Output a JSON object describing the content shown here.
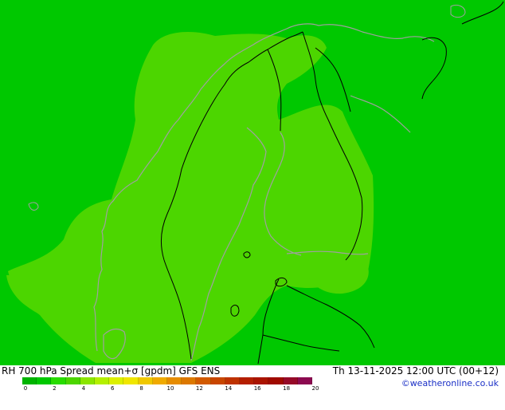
{
  "map": {
    "background_color": "#00c800",
    "field_color": "#4cd600",
    "coast_color": "#a0a0a0",
    "border_color": "#000000"
  },
  "footer": {
    "title_left": "RH 700 hPa Spread mean+σ [gpdm] GFS ENS",
    "title_right": "Th 13-11-2025 12:00 UTC (00+12)",
    "credit": "©weatheronline.co.uk"
  },
  "legend": {
    "colors": [
      "#00b400",
      "#00c800",
      "#28dc00",
      "#4cd600",
      "#8ce600",
      "#b4f000",
      "#dcf000",
      "#f0e600",
      "#f0c800",
      "#f0aa00",
      "#e68c00",
      "#dc7800",
      "#d25a00",
      "#c84600",
      "#be3200",
      "#b41e00",
      "#aa1400",
      "#a00a00",
      "#960a28",
      "#8c0a50"
    ],
    "ticks": [
      "0",
      "2",
      "4",
      "6",
      "8",
      "10",
      "12",
      "14",
      "16",
      "18",
      "20"
    ]
  }
}
